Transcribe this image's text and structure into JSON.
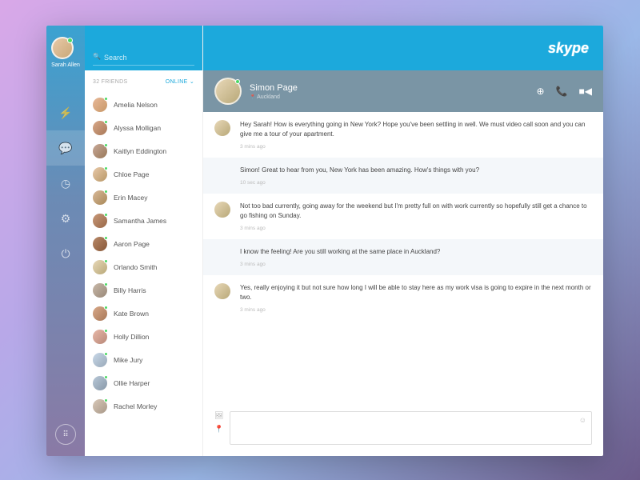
{
  "user": {
    "name": "Sarah Allen"
  },
  "search": {
    "placeholder": "Search"
  },
  "brand": "skype",
  "friends": {
    "count_label": "32 FRIENDS",
    "filter_label": "ONLINE",
    "list": [
      {
        "name": "Amelia Nelson"
      },
      {
        "name": "Alyssa Molligan"
      },
      {
        "name": "Kaitlyn Eddington"
      },
      {
        "name": "Chloe Page"
      },
      {
        "name": "Erin Macey"
      },
      {
        "name": "Samantha James"
      },
      {
        "name": "Aaron Page"
      },
      {
        "name": "Orlando Smith"
      },
      {
        "name": "Billy Harris"
      },
      {
        "name": "Kate Brown"
      },
      {
        "name": "Holly Dillion"
      },
      {
        "name": "Mike Jury"
      },
      {
        "name": "Ollie Harper"
      },
      {
        "name": "Rachel Morley"
      }
    ]
  },
  "conversation": {
    "name": "Simon Page",
    "location": "Auckland",
    "messages": [
      {
        "text": "Hey Sarah! How is everything going in New York? Hope you've been settling in well. We must video call soon and you can give me a tour of your apartment.",
        "time": "3 mins ago",
        "outgoing": false
      },
      {
        "text": "Simon! Great to hear from you, New York has been amazing. How's things with you?",
        "time": "10 sec ago",
        "outgoing": true
      },
      {
        "text": "Not too bad currently, going away for the weekend but I'm pretty full on with work currently so hopefully still get a chance to go fishing on Sunday.",
        "time": "3 mins ago",
        "outgoing": false
      },
      {
        "text": "I know the feeling! Are you still working at the same place in Auckland?",
        "time": "3 mins ago",
        "outgoing": true
      },
      {
        "text": "Yes, really enjoying it but not sure how long I will be able to stay here as my work visa is going to expire in the next month or two.",
        "time": "3 mins ago",
        "outgoing": false
      }
    ]
  }
}
